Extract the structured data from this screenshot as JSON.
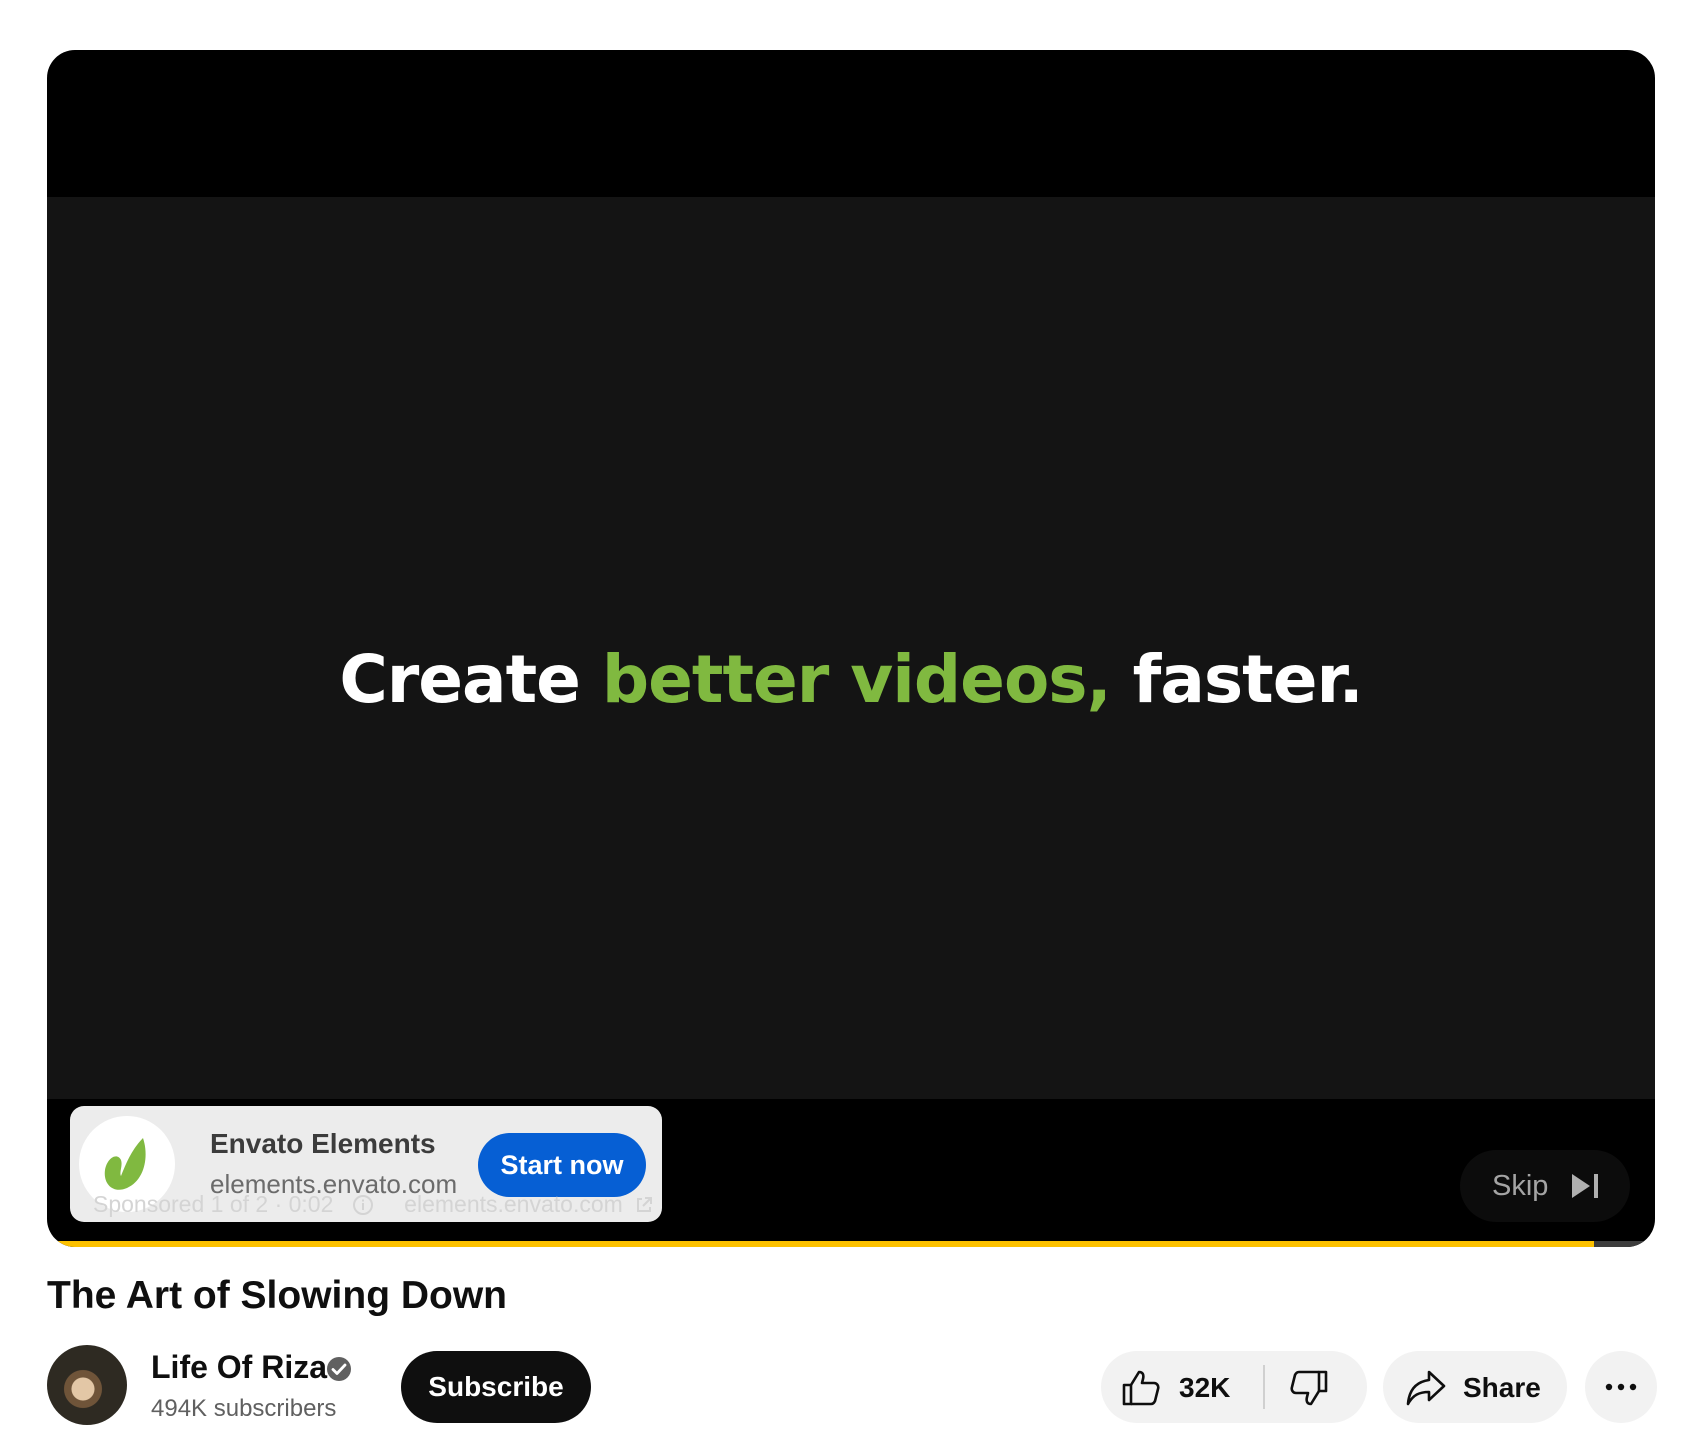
{
  "ad": {
    "headline_white_1": "Create ",
    "headline_green": "better videos,",
    "headline_white_2": " faster.",
    "advertiser_name": "Envato Elements",
    "advertiser_domain": "elements.envato.com",
    "cta_label": "Start now",
    "skip_label": "Skip",
    "sponsored_text": "Sponsored 1 of 2 · 0:02",
    "link_text": "elements.envato.com",
    "progress_fraction": 0.962,
    "colors": {
      "headline_accent": "#80b940",
      "cta_background": "#065fd4",
      "progress": "#fdc100"
    },
    "icons": {
      "logo": "envato-leaf-icon",
      "skip": "skip-next-icon",
      "info": "info-icon",
      "external": "external-link-icon"
    }
  },
  "video": {
    "title": "The Art of Slowing Down"
  },
  "channel": {
    "name": "Life Of Riza",
    "subscribers": "494K subscribers",
    "subscribe_label": "Subscribe",
    "verified_icon": "verified-check-icon"
  },
  "actions": {
    "like_count": "32K",
    "share_label": "Share",
    "icons": {
      "like": "thumbs-up-icon",
      "dislike": "thumbs-down-icon",
      "share": "share-arrow-icon",
      "more": "more-horizontal-icon"
    }
  }
}
